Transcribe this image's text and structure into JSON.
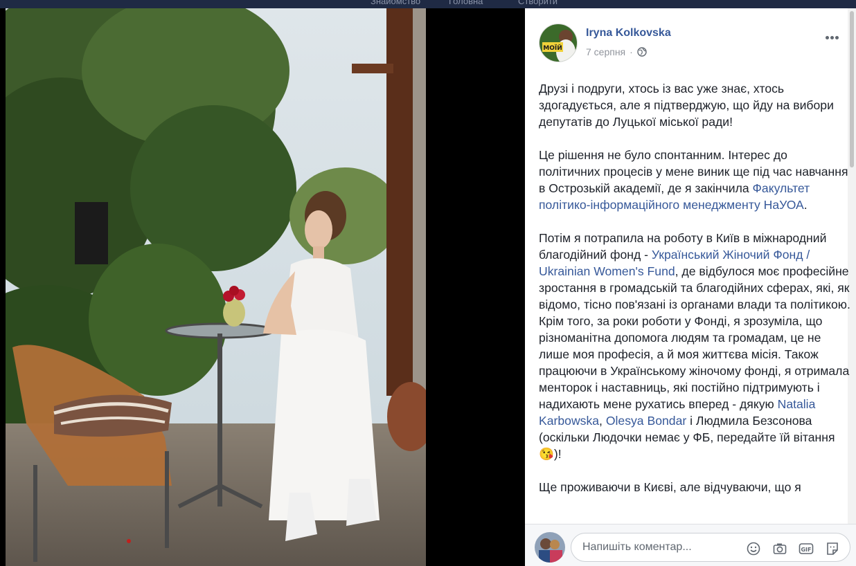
{
  "topbar": {
    "items": [
      "Знайомство",
      "Головна",
      "Створити"
    ]
  },
  "post": {
    "author": "Iryna Kolkovska",
    "date": "7 серпня",
    "avatar_text": "МОЇЙ",
    "paragraphs": [
      [
        {
          "t": "Друзі і подруги, хтось із вас уже знає, хтось здогадується, але я підтверджую, що йду на вибори депутатів до Луцької міської ради!"
        }
      ],
      [
        {
          "t": "Це рішення не було спонтанним. Інтерес до політичних процесів у мене виник ще під час навчання в Острозькій академії, де я закінчила "
        },
        {
          "t": "Факультет політико-інформаційного менеджменту НаУОА",
          "link": true
        },
        {
          "t": "."
        }
      ],
      [
        {
          "t": "Потім я потрапила на роботу в Київ в міжнародний благодійний фонд - "
        },
        {
          "t": "Український Жіночий Фонд / Ukrainian Women's Fund",
          "link": true
        },
        {
          "t": ", де відбулося моє професійне зростання в громадській та благодійних сферах, які, як відомо, тісно пов'язані із органами влади та політикою. Крім того, за роки роботи у Фонді, я зрозуміла, що різноманітна допомога людям та громадам, це не лише моя професія, а й моя життєва місія. Також працюючи в Українському жіночому фонді, я отримала менторок і наставниць, які постійно підтримують і надихають мене рухатись вперед - дякую "
        },
        {
          "t": "Natalia Karbowska",
          "link": true
        },
        {
          "t": ", "
        },
        {
          "t": "Olesya Bondar",
          "link": true
        },
        {
          "t": " і Людмила Безсонова (оскільки Людочки немає у ФБ, передайте їй вітання😘)!"
        }
      ],
      [
        {
          "t": "Ще проживаючи в Києві, але відчуваючи, що я"
        }
      ]
    ]
  },
  "comment": {
    "placeholder": "Напишіть коментар..."
  },
  "icons": [
    "globe-icon",
    "more-options-icon",
    "emoji-icon",
    "camera-icon",
    "gif-icon",
    "sticker-icon"
  ],
  "colors": {
    "link": "#365899",
    "text": "#1d2129",
    "meta": "#90949c"
  }
}
